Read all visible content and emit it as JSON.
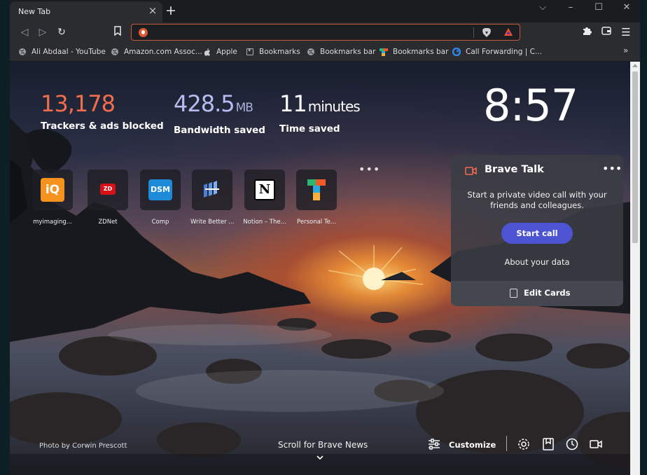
{
  "tab": {
    "title": "New Tab"
  },
  "bookmarks": [
    {
      "label": "Ali Abdaal - YouTube",
      "icon": "globe-icon"
    },
    {
      "label": "Amazon.com Assoc...",
      "icon": "globe-icon"
    },
    {
      "label": "Apple",
      "icon": "apple-icon"
    },
    {
      "label": "Bookmarks",
      "icon": "bookmark-page-icon"
    },
    {
      "label": "Bookmarks bar",
      "icon": "globe-icon"
    },
    {
      "label": "Bookmarks bar",
      "icon": "multicolor-icon"
    },
    {
      "label": "Call Forwarding | C...",
      "icon": "blue-swirl-icon"
    }
  ],
  "stats": [
    {
      "value": "13,178",
      "unit": "",
      "label": "Trackers & ads blocked",
      "color": "#f26d4e"
    },
    {
      "value": "428.5",
      "unit": "MB",
      "label": "Bandwidth saved",
      "color": "#b7bdf0"
    },
    {
      "value": "11",
      "unit": "minutes",
      "label": "Time saved",
      "color": "#ffffff"
    }
  ],
  "clock": "8:57",
  "tiles": [
    {
      "label": "myimaging...",
      "icon": "iq-icon"
    },
    {
      "label": "ZDNet",
      "icon": "zdnet-icon"
    },
    {
      "label": "Comp",
      "icon": "dsm-icon"
    },
    {
      "label": "Write Better ...",
      "icon": "write-better-icon"
    },
    {
      "label": "Notion – The...",
      "icon": "notion-icon"
    },
    {
      "label": "Personal Te...",
      "icon": "personal-te-icon"
    }
  ],
  "talk": {
    "title": "Brave Talk",
    "description": "Start a private video call with your friends and colleagues.",
    "button": "Start call",
    "link": "About your data",
    "edit": "Edit Cards"
  },
  "footer": {
    "credit": "Photo by Corwin Prescott",
    "scroll": "Scroll for Brave News",
    "customize": "Customize"
  }
}
